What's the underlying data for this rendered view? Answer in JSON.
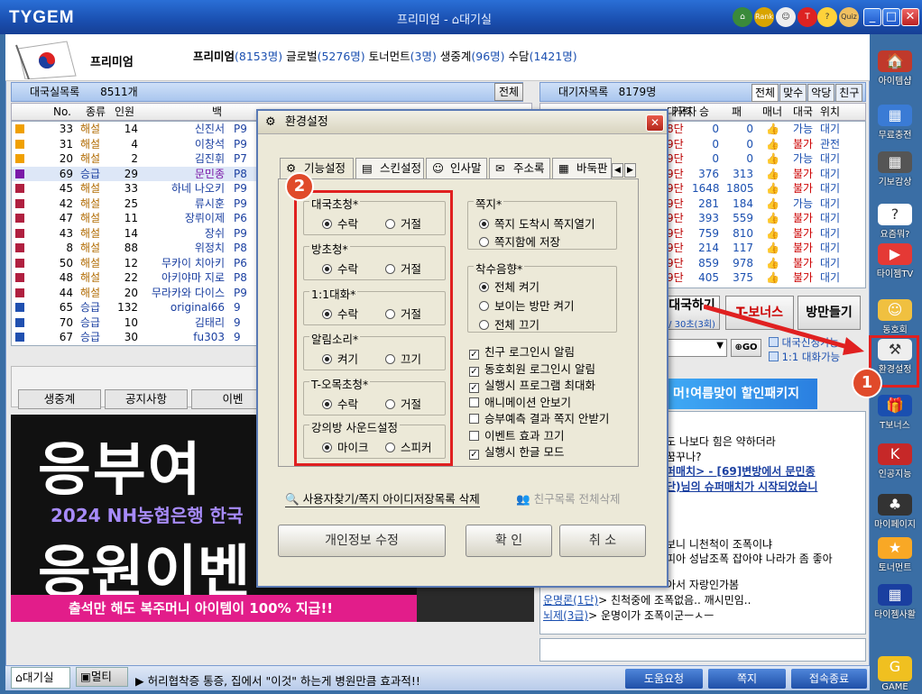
{
  "app": {
    "logo": "TYGEM",
    "title": "프리미엄 - ",
    "title2": "대기실",
    "rank_label": "Rank",
    "quiz_label": "Quiz"
  },
  "header": {
    "grade": "프리미엄",
    "stats": [
      {
        "label": "프리미엄",
        "count": "(8153명)"
      },
      {
        "label": "글로벌",
        "count": "(5276명)"
      },
      {
        "label": "토너먼트",
        "count": "(3명)"
      },
      {
        "label": "생중계",
        "count": "(96명)"
      },
      {
        "label": "수담",
        "count": "(1421명)"
      }
    ]
  },
  "room_panel": {
    "title": "대국실목록",
    "count": "8511개",
    "all_btn": "전체",
    "columns": [
      "No.",
      "종류",
      "인원",
      "백",
      "",
      ""
    ],
    "rows": [
      {
        "no": "33",
        "type": "해설",
        "people": "14",
        "white": "신진서",
        "rank": "P9"
      },
      {
        "no": "31",
        "type": "해설",
        "people": "4",
        "white": "이창석",
        "rank": "P9"
      },
      {
        "no": "20",
        "type": "해설",
        "people": "2",
        "white": "김진휘",
        "rank": "P7"
      },
      {
        "no": "69",
        "type": "승급",
        "people": "29",
        "white": "문민종",
        "rank": "P8"
      },
      {
        "no": "45",
        "type": "해설",
        "people": "33",
        "white": "하네 나오키",
        "rank": "P9"
      },
      {
        "no": "42",
        "type": "해설",
        "people": "25",
        "white": "류시훈",
        "rank": "P9"
      },
      {
        "no": "47",
        "type": "해설",
        "people": "11",
        "white": "장뤼이제",
        "rank": "P6"
      },
      {
        "no": "43",
        "type": "해설",
        "people": "14",
        "white": "장쉬",
        "rank": "P9"
      },
      {
        "no": "8",
        "type": "해설",
        "people": "88",
        "white": "위정치",
        "rank": "P8"
      },
      {
        "no": "50",
        "type": "해설",
        "people": "12",
        "white": "무카이 치아키",
        "rank": "P6"
      },
      {
        "no": "48",
        "type": "해설",
        "people": "22",
        "white": "아키야마 지로",
        "rank": "P8"
      },
      {
        "no": "44",
        "type": "해설",
        "people": "20",
        "white": "무라카와 다이스",
        "rank": "P9"
      },
      {
        "no": "65",
        "type": "승급",
        "people": "132",
        "white": "original66",
        "rank": "9"
      },
      {
        "no": "70",
        "type": "승급",
        "people": "10",
        "white": "김태리",
        "rank": "9"
      },
      {
        "no": "67",
        "type": "승급",
        "people": "30",
        "white": "fu303",
        "rank": "9"
      }
    ]
  },
  "wait_panel": {
    "title": "대기자목록",
    "count": "8179명",
    "tabs": [
      "전체",
      "맞수",
      "악당",
      "친구"
    ],
    "columns": [
      "대국자",
      "기력",
      "승",
      "패",
      "매너",
      "대국",
      "위치"
    ],
    "rows": [
      {
        "rank": "8단",
        "win": "0",
        "lose": "0",
        "play": "가능",
        "loc": "대기"
      },
      {
        "rank": "9단",
        "win": "0",
        "lose": "0",
        "play": "불가",
        "loc": "관전"
      },
      {
        "rank": "9단",
        "win": "0",
        "lose": "0",
        "play": "가능",
        "loc": "대기"
      },
      {
        "rank": "9단",
        "win": "376",
        "lose": "313",
        "play": "불가",
        "loc": "대기"
      },
      {
        "rank": "9단",
        "win": "1648",
        "lose": "1805",
        "play": "불가",
        "loc": "대기"
      },
      {
        "rank": "9단",
        "win": "281",
        "lose": "184",
        "play": "가능",
        "loc": "대기"
      },
      {
        "rank": "9단",
        "win": "393",
        "lose": "559",
        "play": "불가",
        "loc": "대기"
      },
      {
        "rank": "9단",
        "win": "759",
        "lose": "810",
        "play": "불가",
        "loc": "대기"
      },
      {
        "rank": "9단",
        "win": "214",
        "lose": "117",
        "play": "불가",
        "loc": "대기"
      },
      {
        "rank": "9단",
        "win": "859",
        "lose": "978",
        "play": "불가",
        "loc": "대기"
      },
      {
        "rank": "9단",
        "win": "405",
        "lose": "375",
        "play": "불가",
        "loc": "대기"
      }
    ]
  },
  "mid_buttons": {
    "match": "대국하기",
    "match_sub": "/ 30초(3회)",
    "bonus": "T-보너스",
    "make_room": "방만들기",
    "go": "GO",
    "chk1": "대국신청가능",
    "chk2": "1:1 대화가능"
  },
  "promo": {
    "text": "머!여름맞이 할인패키지"
  },
  "lower_tabs": [
    "생중계",
    "공지사항",
    "이벤"
  ],
  "banner": {
    "big1": "응부여",
    "sub": "2024 NH농협은행 한국",
    "big2": "응원이벤",
    "foot": "출석만 해도 복주머니 아이템이 100% 지급!!"
  },
  "chat": [
    {
      "text": "도 나보다 힘은 약하더라"
    },
    {
      "text": "꿈꾸나?"
    },
    {
      "text": "퍼매치> - [69]변방에서 문민종"
    },
    {
      "text": "단)님의 슈퍼매치가 시작되었습니"
    },
    {
      "text": "보니 니천척이 조폭이냐"
    },
    {
      "text": "피아 성남조폭 잡아야 나라가 좀 좋아"
    },
    {
      "text": "아서 자랑인가봄"
    },
    {
      "user": "운명론(1단)",
      "text": " 친척중에 조폭없음.. 깨시민임.."
    },
    {
      "user": "뇌제(3급)",
      "text": " 운명이가 조폭이군ㅡㅅㅡ"
    }
  ],
  "dialog": {
    "title": "환경설정",
    "tabs": [
      "기능설정",
      "스킨설정",
      "인사말",
      "주소록",
      "바둑판"
    ],
    "groups": [
      {
        "label": "대국초청*",
        "opt1": "수락",
        "opt2": "거절",
        "sel": 1
      },
      {
        "label": "방초청*",
        "opt1": "수락",
        "opt2": "거절",
        "sel": 1
      },
      {
        "label": "1:1대화*",
        "opt1": "수락",
        "opt2": "거절",
        "sel": 1
      },
      {
        "label": "알림소리*",
        "opt1": "켜기",
        "opt2": "끄기",
        "sel": 1
      },
      {
        "label": "T-오목초청*",
        "opt1": "수락",
        "opt2": "거절",
        "sel": 1
      },
      {
        "label": "강의방 사운드설정",
        "opt1": "마이크",
        "opt2": "스피커",
        "sel": 1
      }
    ],
    "memo": {
      "label": "쪽지*",
      "opt1": "쪽지 도착시 쪽지열기",
      "opt2": "쪽지함에 저장"
    },
    "sound": {
      "label": "착수음향*",
      "opt1": "전체 켜기",
      "opt2": "보이는 방만 켜기",
      "opt3": "전체 끄기"
    },
    "checks": [
      {
        "label": "친구 로그인시 알림",
        "on": true
      },
      {
        "label": "동호회원 로그인시 알림",
        "on": true
      },
      {
        "label": "실행시 프로그램 최대화",
        "on": true
      },
      {
        "label": "애니메이션 안보기",
        "on": false
      },
      {
        "label": "승부예측 결과 쪽지 안받기",
        "on": false
      },
      {
        "label": "이벤트 효과 끄기",
        "on": false
      },
      {
        "label": "실행시 한글 모드",
        "on": true
      }
    ],
    "link1": "사용자찾기/쪽지 아이디저장목록 삭제",
    "link2": "친구목록 전체삭제",
    "btn_profile": "개인정보 수정",
    "btn_ok": "확  인",
    "btn_cancel": "취  소"
  },
  "sidebar": [
    "아이템샵",
    "무료충전",
    "기보감상",
    "요즘뭐?",
    "타이젬TV",
    "동호회",
    "환경설정",
    "T보너스",
    "인공지능",
    "마이페이지",
    "토너먼트",
    "타이젬사활",
    "GAME"
  ],
  "bottom": {
    "tab_wait": "대기실",
    "tab_multi": "멀티",
    "ticker": "허리협착증 통증, 집에서 \"이것\" 하는게 병원만큼 효과적!!",
    "help": "도움요청",
    "memo": "쪽지",
    "exit": "접속종료"
  },
  "annotations": {
    "n1": "1",
    "n2": "2"
  },
  "colors": {
    "accent": "#1a4fb0",
    "highlight": "#e02020"
  }
}
